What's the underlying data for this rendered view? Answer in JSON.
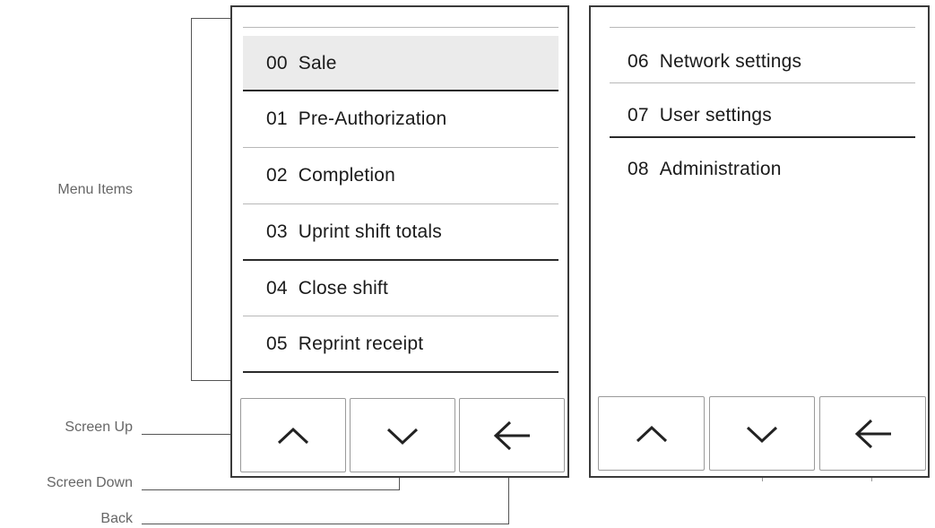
{
  "labels": {
    "menu_items": "Menu Items",
    "screen_up": "Screen Up",
    "screen_down": "Screen Down",
    "back": "Back"
  },
  "left_screen": {
    "items": [
      {
        "num": "00",
        "label": "Sale",
        "selected": true
      },
      {
        "num": "01",
        "label": "Pre-Authorization"
      },
      {
        "num": "02",
        "label": "Completion"
      },
      {
        "num": "03",
        "label": "Uprint shift totals"
      },
      {
        "num": "04",
        "label": "Close shift"
      },
      {
        "num": "05",
        "label": "Reprint receipt"
      }
    ]
  },
  "right_screen": {
    "items": [
      {
        "num": "06",
        "label": "Network settings"
      },
      {
        "num": "07",
        "label": "User settings"
      },
      {
        "num": "08",
        "label": "Administration"
      }
    ]
  },
  "icons": {
    "up": "chevron-up-icon",
    "down": "chevron-down-icon",
    "back": "arrow-left-icon"
  },
  "colors": {
    "selected_bg": "#ebebeb",
    "frame": "#3a3a3a",
    "label": "#666666"
  }
}
